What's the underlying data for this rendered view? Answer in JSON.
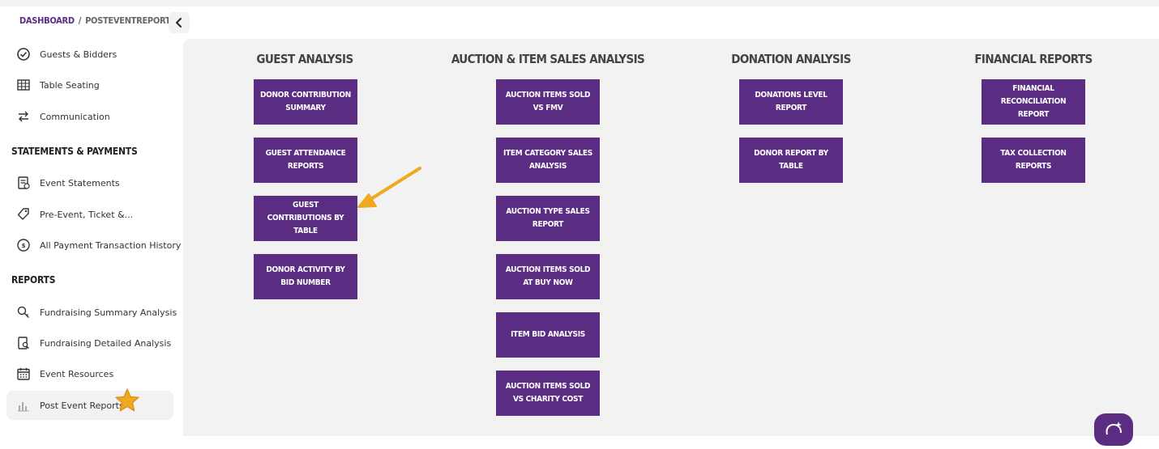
{
  "breadcrumb": {
    "home": "DASHBOARD",
    "separator": "/",
    "current": "POSTEVENTREPORTS"
  },
  "sidebar": {
    "items_top": [
      {
        "label": "Guests & Bidders",
        "icon": "check-circle-icon"
      },
      {
        "label": "Table Seating",
        "icon": "table-grid-icon"
      },
      {
        "label": "Communication",
        "icon": "swap-arrows-icon"
      }
    ],
    "section_statements": "STATEMENTS & PAYMENTS",
    "items_statements": [
      {
        "label": "Event Statements",
        "icon": "statement-icon"
      },
      {
        "label": "Pre-Event, Ticket &...",
        "icon": "tag-icon"
      },
      {
        "label": "All Payment Transaction History",
        "icon": "payment-history-icon"
      }
    ],
    "section_reports": "REPORTS",
    "items_reports": [
      {
        "label": "Fundraising Summary Analysis",
        "icon": "magnifier-key-icon"
      },
      {
        "label": "Fundraising Detailed Analysis",
        "icon": "document-search-icon"
      },
      {
        "label": "Event Resources",
        "icon": "calendar-icon"
      },
      {
        "label": "Post Event Reports",
        "icon": "bar-chart-icon"
      }
    ]
  },
  "columns": [
    {
      "title": "GUEST ANALYSIS",
      "buttons": [
        "DONOR CONTRIBUTION SUMMARY",
        "GUEST ATTENDANCE REPORTS",
        "GUEST CONTRIBUTIONS BY TABLE",
        "DONOR ACTIVITY BY BID NUMBER"
      ]
    },
    {
      "title": "AUCTION & ITEM SALES ANALYSIS",
      "buttons": [
        "AUCTION ITEMS SOLD VS FMV",
        "ITEM CATEGORY SALES ANALYSIS",
        "AUCTION TYPE SALES REPORT",
        "AUCTION ITEMS SOLD AT BUY NOW",
        "ITEM BID ANALYSIS",
        "AUCTION ITEMS SOLD VS CHARITY COST"
      ]
    },
    {
      "title": "DONATION ANALYSIS",
      "buttons": [
        "DONATIONS LEVEL REPORT",
        "DONOR REPORT BY TABLE"
      ]
    },
    {
      "title": "FINANCIAL REPORTS",
      "buttons": [
        "FINANCIAL RECONCILIATION REPORT",
        "TAX COLLECTION REPORTS"
      ]
    }
  ],
  "colors": {
    "brand_purple": "#5a2d82",
    "annotation_orange": "#f0a820",
    "content_bg": "#f2f2f2"
  }
}
